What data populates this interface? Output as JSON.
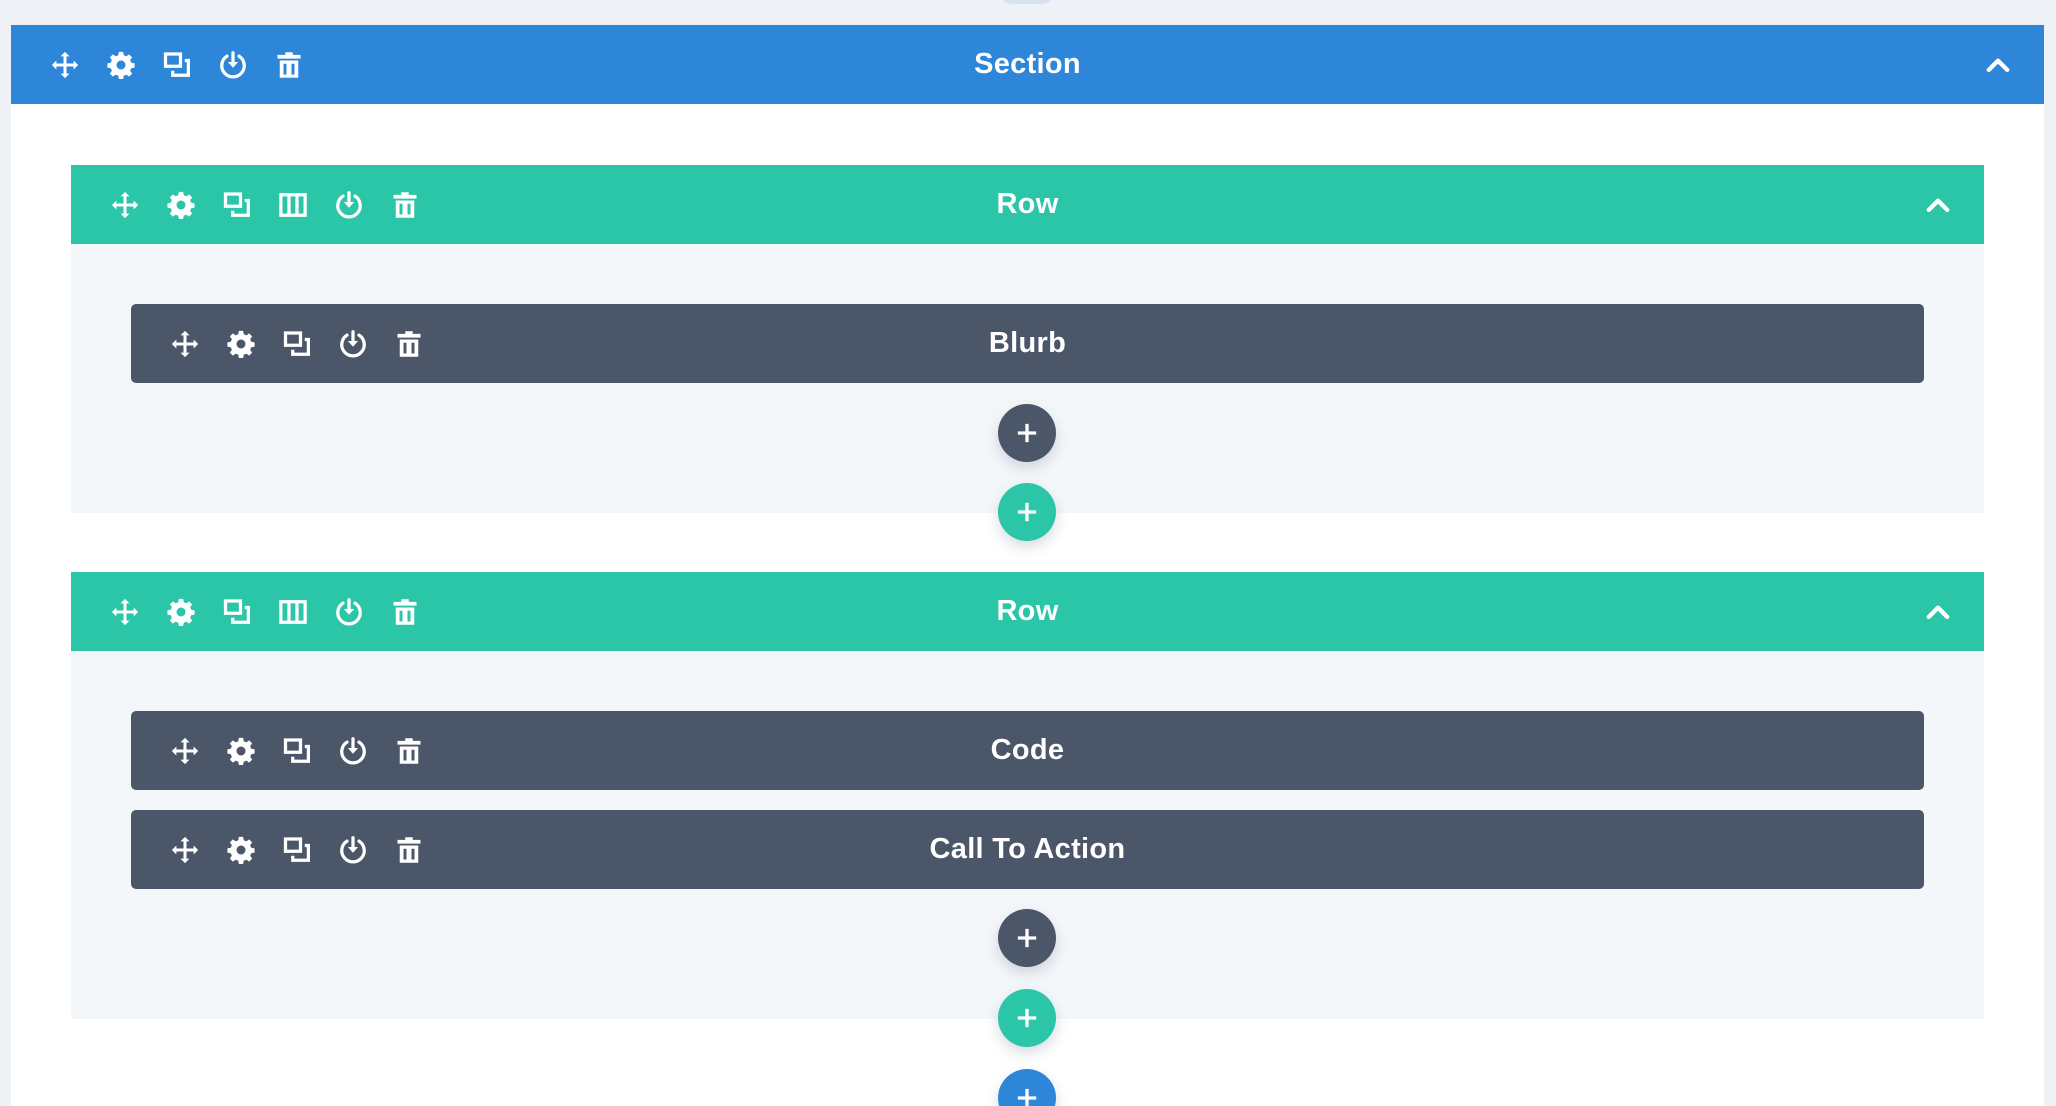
{
  "colors": {
    "section": "#2e86d9",
    "row": "#2bc5a8",
    "module": "#4b5769",
    "canvas": "#eef1f6",
    "row_body": "#f4f7fa"
  },
  "section": {
    "title": "Section",
    "toolbar_icons": [
      "move-icon",
      "gear-icon",
      "duplicate-icon",
      "save-icon",
      "trash-icon"
    ],
    "collapse_icon": "chevron-up-icon"
  },
  "rows": [
    {
      "title": "Row",
      "toolbar_icons": [
        "move-icon",
        "gear-icon",
        "duplicate-icon",
        "columns-icon",
        "save-icon",
        "trash-icon"
      ],
      "collapse_icon": "chevron-up-icon",
      "modules": [
        {
          "title": "Blurb"
        }
      ]
    },
    {
      "title": "Row",
      "toolbar_icons": [
        "move-icon",
        "gear-icon",
        "duplicate-icon",
        "columns-icon",
        "save-icon",
        "trash-icon"
      ],
      "collapse_icon": "chevron-up-icon",
      "modules": [
        {
          "title": "Code"
        },
        {
          "title": "Call To Action"
        }
      ]
    }
  ],
  "module_toolbar_icons": [
    "move-icon",
    "gear-icon",
    "duplicate-icon",
    "save-icon",
    "trash-icon"
  ],
  "add_buttons": [
    "add-module-button",
    "add-row-button",
    "add-section-button"
  ]
}
